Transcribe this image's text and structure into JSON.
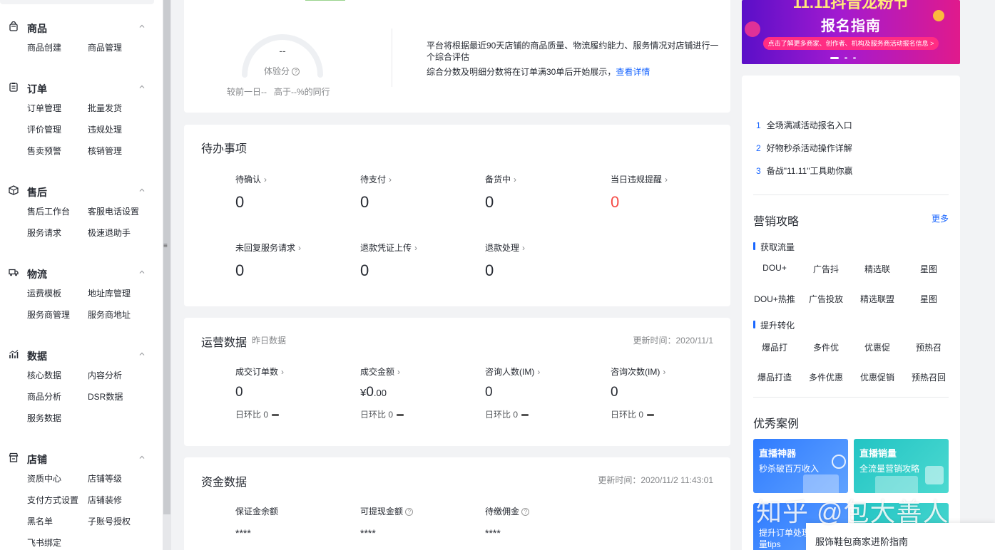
{
  "sidebar": {
    "sections": [
      {
        "title": "商品",
        "icon": "bag-icon",
        "items": [
          "商品创建",
          "商品管理"
        ]
      },
      {
        "title": "订单",
        "icon": "clipboard-icon",
        "items": [
          "订单管理",
          "批量发货",
          "评价管理",
          "违规处理",
          "售卖预警",
          "核销管理"
        ]
      },
      {
        "title": "售后",
        "icon": "box-icon",
        "items": [
          "售后工作台",
          "客服电话设置",
          "服务请求",
          "极速退助手"
        ]
      },
      {
        "title": "物流",
        "icon": "truck-icon",
        "items": [
          "运费模板",
          "地址库管理",
          "服务商管理",
          "服务商地址"
        ]
      },
      {
        "title": "数据",
        "icon": "chart-icon",
        "items": [
          "核心数据",
          "内容分析",
          "商品分析",
          "DSR数据",
          "服务数据"
        ]
      },
      {
        "title": "店铺",
        "icon": "store-icon",
        "items": [
          "资质中心",
          "店铺等级",
          "支付方式设置",
          "店铺装修",
          "黑名单",
          "子账号授权",
          "飞书绑定"
        ]
      }
    ]
  },
  "score": {
    "value": "--",
    "label": "体验分",
    "compare": "较前一日--   高于--%的同行",
    "desc1": "平台将根据最近90天店铺的商品质量、物流履约能力、服务情况对店铺进行一个综合评估",
    "desc2": "综合分数及明细分数将在订单满30单后开始展示，",
    "link": "查看详情"
  },
  "todo": {
    "title": "待办事项",
    "items": [
      {
        "label": "待确认",
        "value": "0"
      },
      {
        "label": "待支付",
        "value": "0"
      },
      {
        "label": "备货中",
        "value": "0"
      },
      {
        "label": "当日违规提醒",
        "value": "0"
      },
      {
        "label": "未回复服务请求",
        "value": "0"
      },
      {
        "label": "退款凭证上传",
        "value": "0"
      },
      {
        "label": "退款处理",
        "value": "0"
      }
    ]
  },
  "ops": {
    "title": "运营数据",
    "subtitle": "昨日数据",
    "time": "更新时间：2020/11/1",
    "items": [
      {
        "label": "成交订单数",
        "value": "0",
        "change": "日环比 0"
      },
      {
        "label": "成交金额",
        "currency": "¥",
        "value": "0",
        "decimals": ".00",
        "change": "日环比 0"
      },
      {
        "label": "咨询人数(IM)",
        "value": "0",
        "change": "日环比 0"
      },
      {
        "label": "咨询次数(IM)",
        "value": "0",
        "change": "日环比 0"
      }
    ]
  },
  "funds": {
    "title": "资金数据",
    "time": "更新时间：2020/11/2 11:43:01",
    "items": [
      {
        "label": "保证金余额",
        "value": "****"
      },
      {
        "label": "可提现金额",
        "value": "****"
      },
      {
        "label": "待缴佣金",
        "value": "****"
      }
    ]
  },
  "banner": {
    "title": "11.11抖音龙粉节",
    "subtitle": "报名指南",
    "cta": "点击了解更多商家、创作者、机构及服务商活动报名信息 >"
  },
  "notices": [
    {
      "num": "1",
      "text": "全场满减活动报名入口"
    },
    {
      "num": "2",
      "text": "好物秒杀活动操作详解"
    },
    {
      "num": "3",
      "text": "备战\"11.11\"工具助你赢"
    }
  ],
  "marketing": {
    "title": "营销攻略",
    "more": "更多",
    "group1": "获取流量",
    "row1": [
      "DOU+",
      "广告抖",
      "精选联",
      "星图"
    ],
    "row2": [
      "DOU+热推",
      "广告投放",
      "精选联盟",
      "星图"
    ],
    "group2": "提升转化",
    "row3": [
      "爆品打",
      "多件优",
      "优惠促",
      "预热召"
    ],
    "row4": [
      "爆品打造",
      "多件优惠",
      "优惠促销",
      "预热召回"
    ]
  },
  "cases": {
    "title": "优秀案例",
    "items": [
      {
        "title": "直播神器",
        "sub": "秒杀破百万收入"
      },
      {
        "title": "直播销量",
        "sub": "全流量营销攻略"
      },
      {
        "title": "",
        "sub": "提升订单处理 销量tips"
      },
      {
        "title": "",
        "sub": ""
      }
    ],
    "popup": "服饰鞋包商家进阶指南"
  },
  "watermark": "知乎 @包大善人",
  "colors": {
    "accent": "#1966ff",
    "danger": "#f54a45",
    "text": "#252931",
    "muted": "#85878a"
  }
}
